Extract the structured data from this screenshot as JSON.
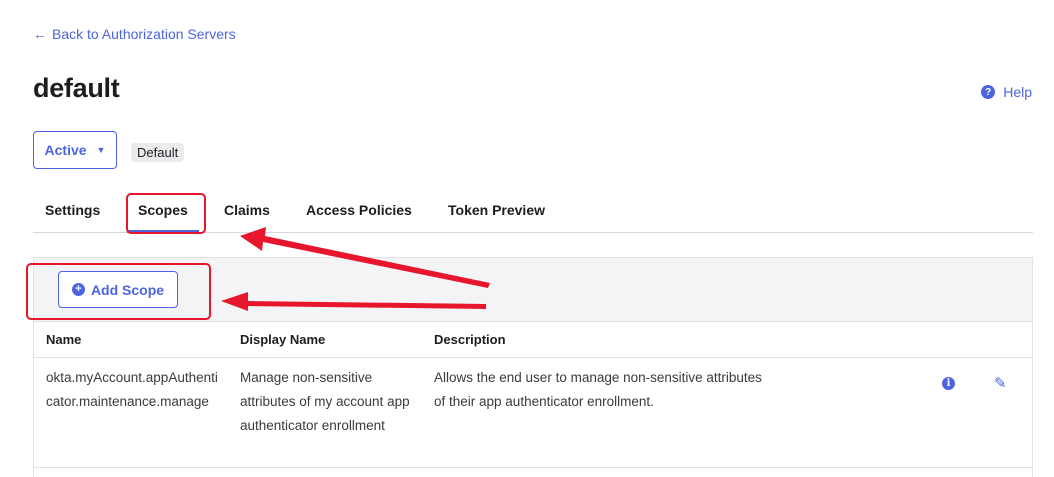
{
  "nav": {
    "back_label": "Back to Authorization Servers"
  },
  "page": {
    "title": "default"
  },
  "help": {
    "label": "Help",
    "icon": "question-icon"
  },
  "status": {
    "selected": "Active",
    "badge": "Default"
  },
  "tabs": [
    {
      "label": "Settings"
    },
    {
      "label": "Scopes",
      "active": true
    },
    {
      "label": "Claims"
    },
    {
      "label": "Access Policies"
    },
    {
      "label": "Token Preview"
    }
  ],
  "toolbar": {
    "add_scope_label": "Add Scope"
  },
  "table": {
    "columns": [
      "Name",
      "Display Name",
      "Description"
    ],
    "rows": [
      {
        "name": "okta.myAccount.appAuthenticator.maintenance.manage",
        "display_name": "Manage non-sensitive attributes of my account app authenticator enrollment",
        "description": "Allows the end user to manage non-sensitive attributes of their app authenticator enrollment."
      }
    ]
  },
  "colors": {
    "accent": "#4c64e0",
    "annotation": "#e8162c"
  }
}
